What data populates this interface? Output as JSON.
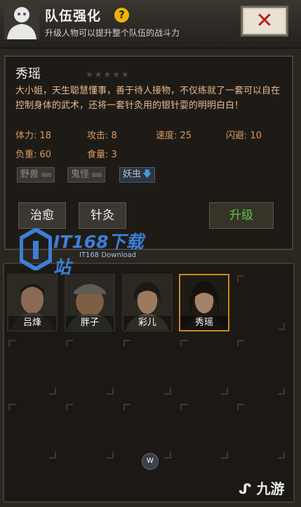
{
  "header": {
    "title": "队伍强化",
    "help": "?",
    "subtitle": "升级人物可以提升整个队伍的战斗力",
    "close": "✕"
  },
  "character": {
    "name": "秀瑶",
    "stars": "★★★★★",
    "star_rating": 0,
    "description": "大小姐，天生聪慧懂事，善于待人接物，不仅练就了一套可以自在控制身体的武术，还将一套针灸用的银针耍的明明白白！",
    "stats": {
      "physique": "体力: 18",
      "attack": "攻击: 8",
      "speed": "速度: 25",
      "dodge": "闪避: 10",
      "load": "负重: 60",
      "food": "食量: 3"
    },
    "tags": [
      {
        "label": "野兽",
        "active": false
      },
      {
        "label": "鬼怪",
        "active": false
      },
      {
        "label": "妖虫",
        "active": true
      }
    ],
    "buttons": {
      "heal": "治愈",
      "acupuncture": "针灸",
      "upgrade": "升级"
    }
  },
  "team": {
    "members": [
      {
        "name": "吕烽",
        "selected": false
      },
      {
        "name": "胖子",
        "selected": false
      },
      {
        "name": "彩儿",
        "selected": false
      },
      {
        "name": "秀瑶",
        "selected": true
      }
    ],
    "page_indicator": "W"
  },
  "watermarks": {
    "it168_big": "IT168下载站",
    "it168_small": "IT168 Download",
    "jiuyou": "九游"
  }
}
